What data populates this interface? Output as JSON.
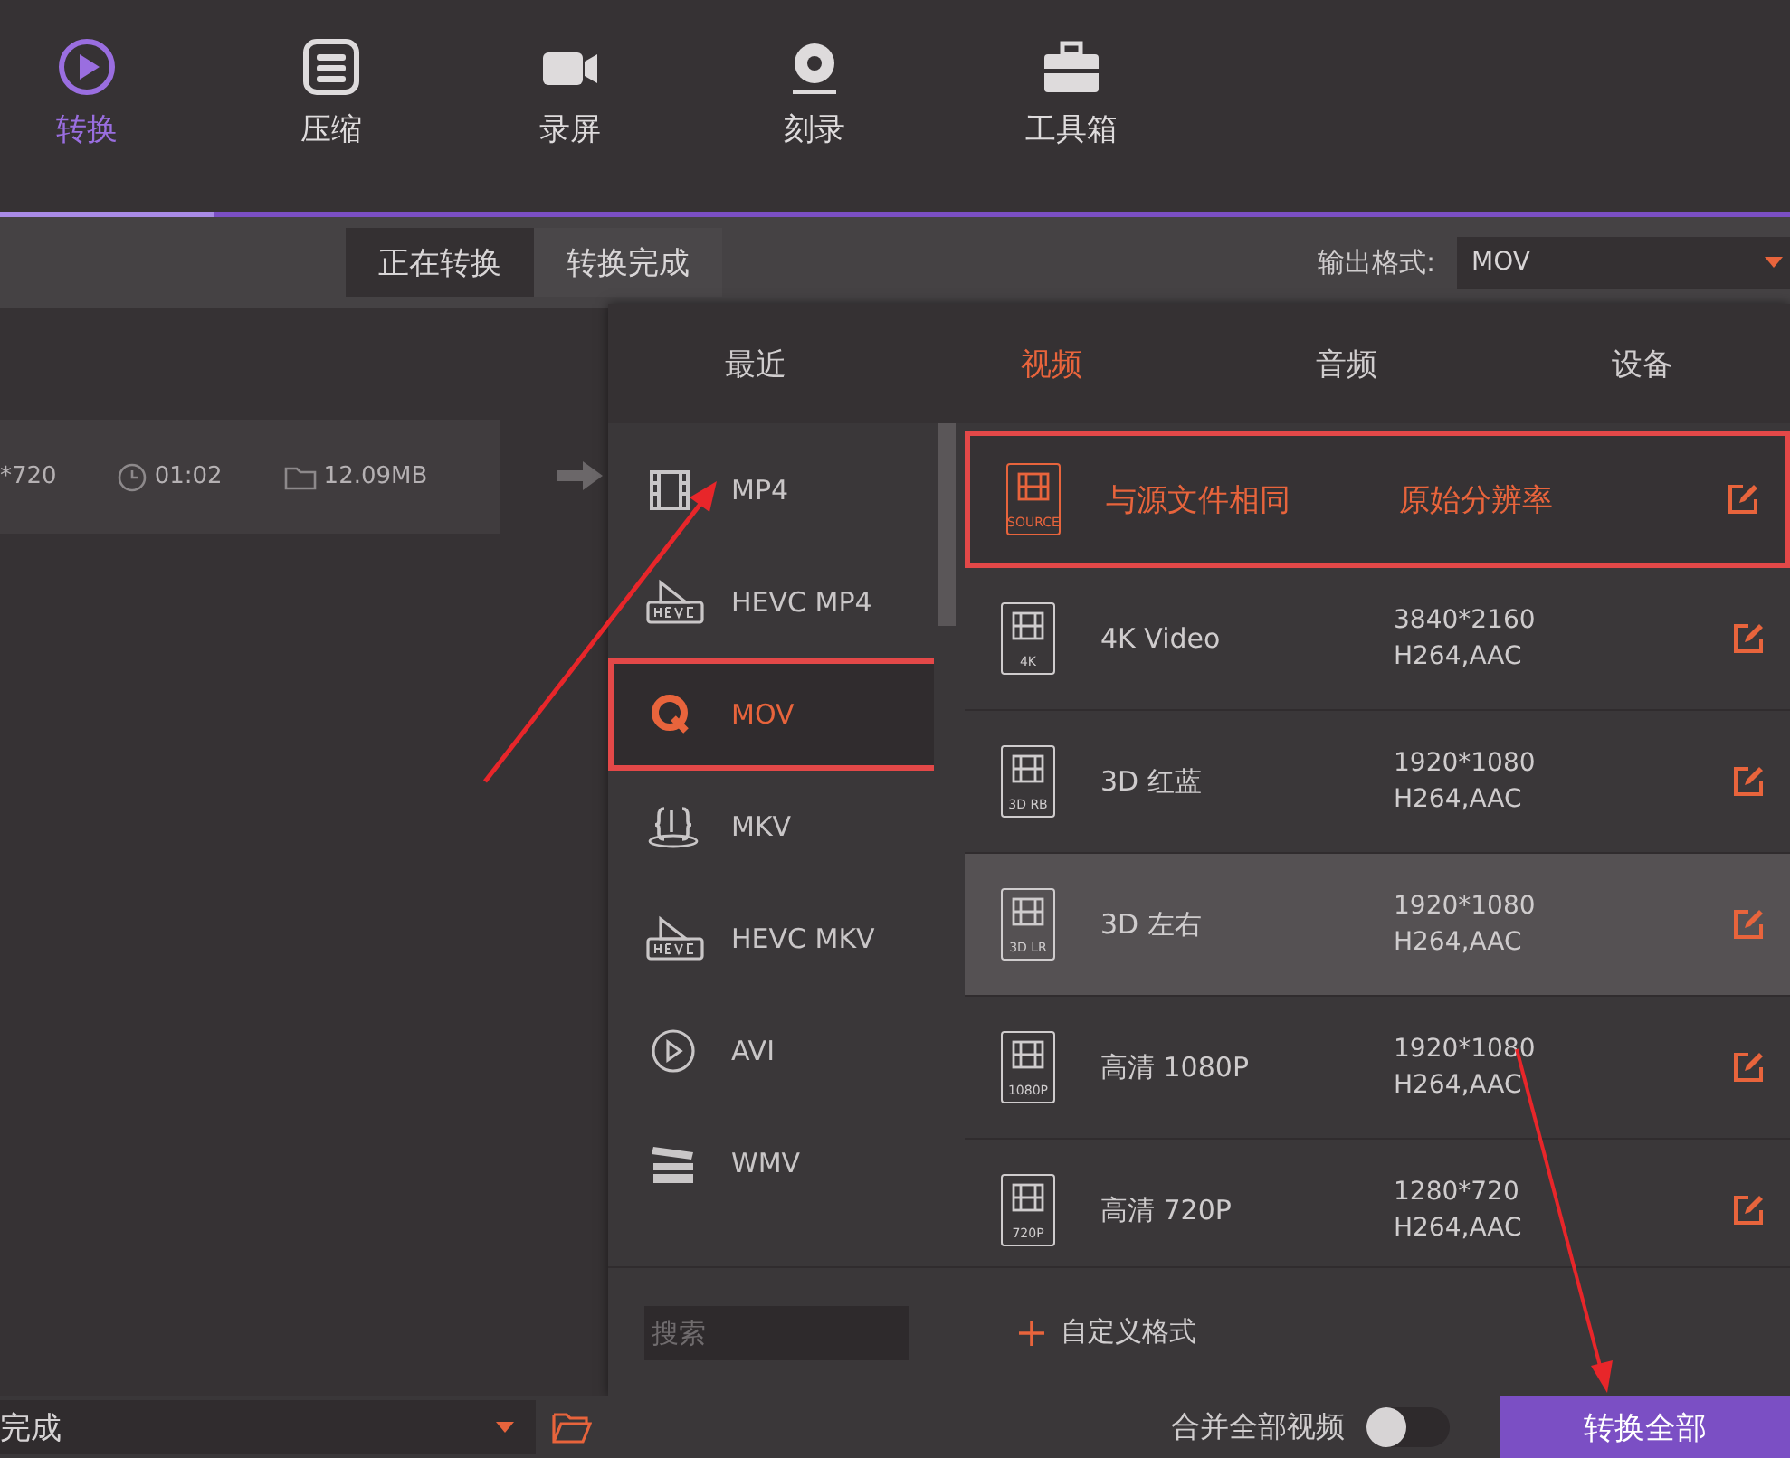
{
  "nav_tabs": [
    {
      "label": "转换",
      "kind": "convert",
      "selected": true
    },
    {
      "label": "压缩",
      "kind": "compress",
      "selected": false
    },
    {
      "label": "录屏",
      "kind": "record",
      "selected": false
    },
    {
      "label": "刻录",
      "kind": "burn",
      "selected": false
    },
    {
      "label": "工具箱",
      "kind": "toolbox",
      "selected": false
    }
  ],
  "sub_tabs": [
    {
      "label": "正在转换",
      "selected": true
    },
    {
      "label": "转换完成",
      "selected": false
    }
  ],
  "output_format": {
    "label": "输出格式:",
    "value": "MOV"
  },
  "file": {
    "resolution": "*720",
    "duration": "01:02",
    "size": "12.09MB"
  },
  "format_popup": {
    "tabs": [
      {
        "label": "最近",
        "selected": false
      },
      {
        "label": "视频",
        "selected": true
      },
      {
        "label": "音频",
        "selected": false
      },
      {
        "label": "设备",
        "selected": false
      }
    ],
    "formats": [
      {
        "label": "MP4",
        "kind": "film",
        "selected": false
      },
      {
        "label": "HEVC MP4",
        "kind": "hevc",
        "selected": false
      },
      {
        "label": "MOV",
        "kind": "q",
        "selected": true
      },
      {
        "label": "MKV",
        "kind": "braces",
        "selected": false
      },
      {
        "label": "HEVC MKV",
        "kind": "hevc",
        "selected": false
      },
      {
        "label": "AVI",
        "kind": "play",
        "selected": false
      },
      {
        "label": "WMV",
        "kind": "clapper",
        "selected": false
      }
    ],
    "presets": [
      {
        "name": "与源文件相同",
        "resolution": "原始分辨率",
        "badge": "SOURCE",
        "selected": true,
        "highlighted": false
      },
      {
        "name": "4K Video",
        "resolution": "3840*2160",
        "codec": "H264,AAC",
        "badge": "4K",
        "selected": false,
        "highlighted": false
      },
      {
        "name": "3D 红蓝",
        "resolution": "1920*1080",
        "codec": "H264,AAC",
        "badge": "3D RB",
        "selected": false,
        "highlighted": false
      },
      {
        "name": "3D 左右",
        "resolution": "1920*1080",
        "codec": "H264,AAC",
        "badge": "3D LR",
        "selected": false,
        "highlighted": true
      },
      {
        "name": "高清 1080P",
        "resolution": "1920*1080",
        "codec": "H264,AAC",
        "badge": "1080P",
        "selected": false,
        "highlighted": false
      },
      {
        "name": "高清 720P",
        "resolution": "1280*720",
        "codec": "H264,AAC",
        "badge": "720P",
        "selected": false,
        "highlighted": false
      }
    ],
    "search": {
      "placeholder": "搜索"
    },
    "custom_format": "自定义格式"
  },
  "bottom_bar": {
    "destination": "完成",
    "merge_label": "合并全部视频",
    "merge_on": false,
    "convert_all": "转换全部"
  }
}
